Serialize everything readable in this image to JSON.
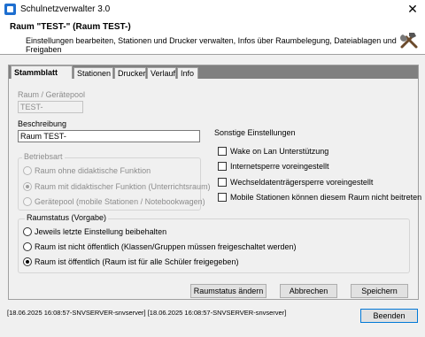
{
  "window": {
    "title": "Schulnetzverwalter 3.0",
    "close_glyph": "✕"
  },
  "header": {
    "title": "Raum \"TEST-\" (Raum TEST-)",
    "subtitle": "Einstellungen bearbeiten, Stationen und Drucker verwalten, Infos über Raumbelegung, Dateiablagen und Freigaben",
    "icon": "tools-icon"
  },
  "tabs": [
    {
      "label": "Stammblatt",
      "active": true
    },
    {
      "label": "Stationen",
      "active": false
    },
    {
      "label": "Drucker",
      "active": false
    },
    {
      "label": "Verlauf",
      "active": false
    },
    {
      "label": "Info",
      "active": false
    }
  ],
  "fields": {
    "raum_label": "Raum / Gerätepool",
    "raum_value": "TEST-",
    "beschreibung_label": "Beschreibung",
    "beschreibung_value": "Raum TEST-"
  },
  "betriebsart": {
    "title": "Betriebsart",
    "options": [
      {
        "label": "Raum ohne didaktische Funktion",
        "checked": false
      },
      {
        "label": "Raum mit didaktischer Funktion (Unterrichtsraum)",
        "checked": true
      },
      {
        "label": "Gerätepool (mobile Stationen / Notebookwagen)",
        "checked": false
      }
    ]
  },
  "sonstige": {
    "title": "Sonstige Einstellungen",
    "options": [
      {
        "label": "Wake on Lan Unterstützung",
        "checked": false
      },
      {
        "label": "Internetsperre voreingestellt",
        "checked": false
      },
      {
        "label": "Wechseldatenträgersperre voreingestellt",
        "checked": false
      },
      {
        "label": "Mobile Stationen können diesem Raum nicht beitreten",
        "checked": false
      }
    ]
  },
  "raumstatus": {
    "title": "Raumstatus (Vorgabe)",
    "options": [
      {
        "label": "Jeweils letzte Einstellung beibehalten",
        "checked": false
      },
      {
        "label": "Raum ist nicht öffentlich (Klassen/Gruppen müssen freigeschaltet werden)",
        "checked": false
      },
      {
        "label": "Raum ist öffentlich (Raum ist für alle Schüler freigegeben)",
        "checked": true
      }
    ]
  },
  "buttons": {
    "raumstatus": "Raumstatus ändern",
    "abbrechen": "Abbrechen",
    "speichern": "Speichern",
    "beenden": "Beenden"
  },
  "status": "[18.06.2025 16:08:57-SNVSERVER-snvserver] [18.06.2025 16:08:57-SNVSERVER-snvserver]"
}
